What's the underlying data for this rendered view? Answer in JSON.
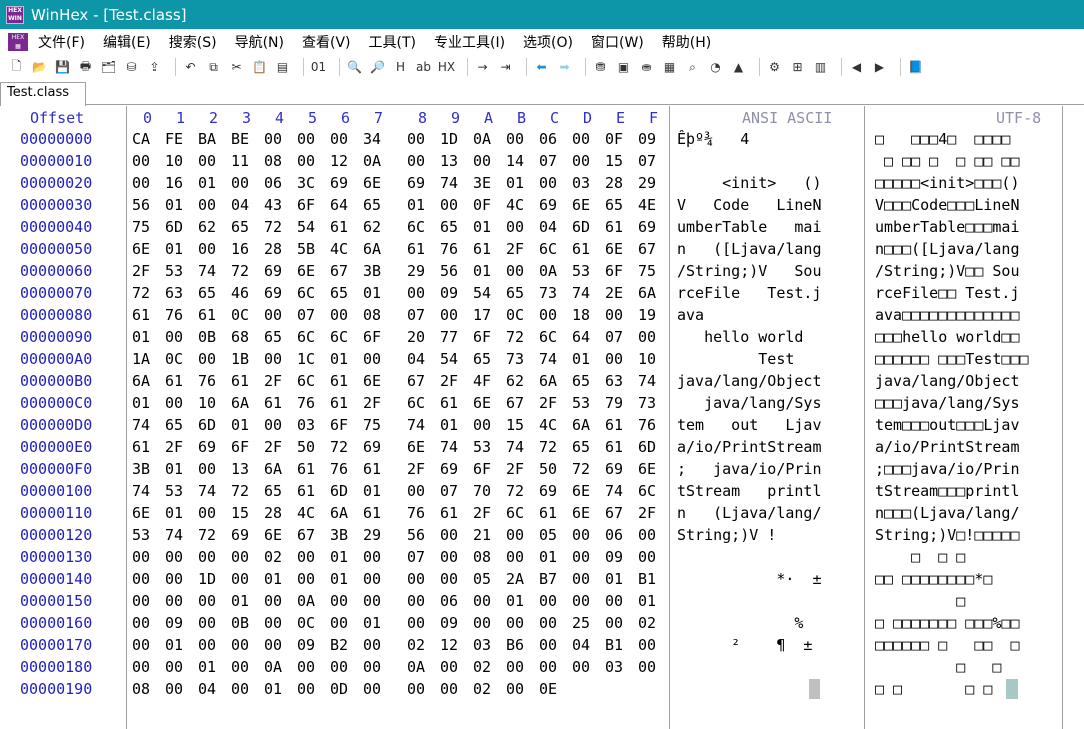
{
  "window": {
    "title": "WinHex - [Test.class]"
  },
  "menu": [
    "文件(F)",
    "编辑(E)",
    "搜索(S)",
    "导航(N)",
    "查看(V)",
    "工具(T)",
    "专业工具(I)",
    "选项(O)",
    "窗口(W)",
    "帮助(H)"
  ],
  "toolbar_icons": [
    "new-file-icon",
    "open-folder-icon",
    "save-icon",
    "print-icon",
    "properties-icon",
    "disk-icon",
    "export-icon",
    "undo-icon",
    "copy-icon",
    "cut-icon",
    "paste-icon",
    "paste-special-icon",
    "binary-icon",
    "find-icon",
    "find-next-icon",
    "find-hex-icon",
    "replace-icon",
    "replace-hex-icon",
    "goto-offset-icon",
    "goto-position-icon",
    "back-icon",
    "forward-icon",
    "disk-open-icon",
    "ram-icon",
    "disk-tools-icon",
    "calculator-icon",
    "search-tool-icon",
    "chart-icon",
    "mask-icon",
    "script-icon",
    "compare-icon",
    "table-icon",
    "prev-block-icon",
    "next-block-icon",
    "help-book-icon"
  ],
  "tab": {
    "label": "Test.class"
  },
  "header": {
    "offset": "Offset",
    "columns": [
      "0",
      "1",
      "2",
      "3",
      "4",
      "5",
      "6",
      "7",
      "8",
      "9",
      "A",
      "B",
      "C",
      "D",
      "E",
      "F"
    ],
    "ansi": "ANSI ASCII",
    "utf": "UTF-8"
  },
  "rows": [
    {
      "offset": "00000000",
      "hex": [
        "CA",
        "FE",
        "BA",
        "BE",
        "00",
        "00",
        "00",
        "34",
        "00",
        "1D",
        "0A",
        "00",
        "06",
        "00",
        "0F",
        "09"
      ],
      "ansi": "Êþº¾   4        ",
      "utf": "□   □□□4□  □□□□"
    },
    {
      "offset": "00000010",
      "hex": [
        "00",
        "10",
        "00",
        "11",
        "08",
        "00",
        "12",
        "0A",
        "00",
        "13",
        "00",
        "14",
        "07",
        "00",
        "15",
        "07"
      ],
      "ansi": "                ",
      "utf": " □ □□ □  □ □□ □□"
    },
    {
      "offset": "00000020",
      "hex": [
        "00",
        "16",
        "01",
        "00",
        "06",
        "3C",
        "69",
        "6E",
        "69",
        "74",
        "3E",
        "01",
        "00",
        "03",
        "28",
        "29"
      ],
      "ansi": "     <init>   ()",
      "utf": "□□□□□<init>□□□()"
    },
    {
      "offset": "00000030",
      "hex": [
        "56",
        "01",
        "00",
        "04",
        "43",
        "6F",
        "64",
        "65",
        "01",
        "00",
        "0F",
        "4C",
        "69",
        "6E",
        "65",
        "4E"
      ],
      "ansi": "V   Code   LineN",
      "utf": "V□□□Code□□□LineN"
    },
    {
      "offset": "00000040",
      "hex": [
        "75",
        "6D",
        "62",
        "65",
        "72",
        "54",
        "61",
        "62",
        "6C",
        "65",
        "01",
        "00",
        "04",
        "6D",
        "61",
        "69"
      ],
      "ansi": "umberTable   mai",
      "utf": "umberTable□□□mai"
    },
    {
      "offset": "00000050",
      "hex": [
        "6E",
        "01",
        "00",
        "16",
        "28",
        "5B",
        "4C",
        "6A",
        "61",
        "76",
        "61",
        "2F",
        "6C",
        "61",
        "6E",
        "67"
      ],
      "ansi": "n   ([Ljava/lang",
      "utf": "n□□□([Ljava/lang"
    },
    {
      "offset": "00000060",
      "hex": [
        "2F",
        "53",
        "74",
        "72",
        "69",
        "6E",
        "67",
        "3B",
        "29",
        "56",
        "01",
        "00",
        "0A",
        "53",
        "6F",
        "75"
      ],
      "ansi": "/String;)V   Sou",
      "utf": "/String;)V□□ Sou"
    },
    {
      "offset": "00000070",
      "hex": [
        "72",
        "63",
        "65",
        "46",
        "69",
        "6C",
        "65",
        "01",
        "00",
        "09",
        "54",
        "65",
        "73",
        "74",
        "2E",
        "6A"
      ],
      "ansi": "rceFile   Test.j",
      "utf": "rceFile□□ Test.j"
    },
    {
      "offset": "00000080",
      "hex": [
        "61",
        "76",
        "61",
        "0C",
        "00",
        "07",
        "00",
        "08",
        "07",
        "00",
        "17",
        "0C",
        "00",
        "18",
        "00",
        "19"
      ],
      "ansi": "ava             ",
      "utf": "ava□□□□□□□□□□□□□"
    },
    {
      "offset": "00000090",
      "hex": [
        "01",
        "00",
        "0B",
        "68",
        "65",
        "6C",
        "6C",
        "6F",
        "20",
        "77",
        "6F",
        "72",
        "6C",
        "64",
        "07",
        "00"
      ],
      "ansi": "   hello world  ",
      "utf": "□□□hello world□□"
    },
    {
      "offset": "000000A0",
      "hex": [
        "1A",
        "0C",
        "00",
        "1B",
        "00",
        "1C",
        "01",
        "00",
        "04",
        "54",
        "65",
        "73",
        "74",
        "01",
        "00",
        "10"
      ],
      "ansi": "         Test   ",
      "utf": "□□□□□□ □□□Test□□□"
    },
    {
      "offset": "000000B0",
      "hex": [
        "6A",
        "61",
        "76",
        "61",
        "2F",
        "6C",
        "61",
        "6E",
        "67",
        "2F",
        "4F",
        "62",
        "6A",
        "65",
        "63",
        "74"
      ],
      "ansi": "java/lang/Object",
      "utf": "java/lang/Object"
    },
    {
      "offset": "000000C0",
      "hex": [
        "01",
        "00",
        "10",
        "6A",
        "61",
        "76",
        "61",
        "2F",
        "6C",
        "61",
        "6E",
        "67",
        "2F",
        "53",
        "79",
        "73"
      ],
      "ansi": "   java/lang/Sys",
      "utf": "□□□java/lang/Sys"
    },
    {
      "offset": "000000D0",
      "hex": [
        "74",
        "65",
        "6D",
        "01",
        "00",
        "03",
        "6F",
        "75",
        "74",
        "01",
        "00",
        "15",
        "4C",
        "6A",
        "61",
        "76"
      ],
      "ansi": "tem   out   Ljav",
      "utf": "tem□□□out□□□Ljav"
    },
    {
      "offset": "000000E0",
      "hex": [
        "61",
        "2F",
        "69",
        "6F",
        "2F",
        "50",
        "72",
        "69",
        "6E",
        "74",
        "53",
        "74",
        "72",
        "65",
        "61",
        "6D"
      ],
      "ansi": "a/io/PrintStream",
      "utf": "a/io/PrintStream"
    },
    {
      "offset": "000000F0",
      "hex": [
        "3B",
        "01",
        "00",
        "13",
        "6A",
        "61",
        "76",
        "61",
        "2F",
        "69",
        "6F",
        "2F",
        "50",
        "72",
        "69",
        "6E"
      ],
      "ansi": ";   java/io/Prin",
      "utf": ";□□□java/io/Prin"
    },
    {
      "offset": "00000100",
      "hex": [
        "74",
        "53",
        "74",
        "72",
        "65",
        "61",
        "6D",
        "01",
        "00",
        "07",
        "70",
        "72",
        "69",
        "6E",
        "74",
        "6C"
      ],
      "ansi": "tStream   printl",
      "utf": "tStream□□□printl"
    },
    {
      "offset": "00000110",
      "hex": [
        "6E",
        "01",
        "00",
        "15",
        "28",
        "4C",
        "6A",
        "61",
        "76",
        "61",
        "2F",
        "6C",
        "61",
        "6E",
        "67",
        "2F"
      ],
      "ansi": "n   (Ljava/lang/",
      "utf": "n□□□(Ljava/lang/"
    },
    {
      "offset": "00000120",
      "hex": [
        "53",
        "74",
        "72",
        "69",
        "6E",
        "67",
        "3B",
        "29",
        "56",
        "00",
        "21",
        "00",
        "05",
        "00",
        "06",
        "00"
      ],
      "ansi": "String;)V !     ",
      "utf": "String;)V□!□□□□□"
    },
    {
      "offset": "00000130",
      "hex": [
        "00",
        "00",
        "00",
        "00",
        "02",
        "00",
        "01",
        "00",
        "07",
        "00",
        "08",
        "00",
        "01",
        "00",
        "09",
        "00"
      ],
      "ansi": "                ",
      "utf": "    □  □ □      "
    },
    {
      "offset": "00000140",
      "hex": [
        "00",
        "00",
        "1D",
        "00",
        "01",
        "00",
        "01",
        "00",
        "00",
        "00",
        "05",
        "2A",
        "B7",
        "00",
        "01",
        "B1"
      ],
      "ansi": "           *·  ±",
      "utf": "□□ □□□□□□□□*□   "
    },
    {
      "offset": "00000150",
      "hex": [
        "00",
        "00",
        "00",
        "01",
        "00",
        "0A",
        "00",
        "00",
        "00",
        "06",
        "00",
        "01",
        "00",
        "00",
        "00",
        "01"
      ],
      "ansi": "                ",
      "utf": "         □      "
    },
    {
      "offset": "00000160",
      "hex": [
        "00",
        "09",
        "00",
        "0B",
        "00",
        "0C",
        "00",
        "01",
        "00",
        "09",
        "00",
        "00",
        "00",
        "25",
        "00",
        "02"
      ],
      "ansi": "             %  ",
      "utf": "□ □□□□□□□ □□□%□□"
    },
    {
      "offset": "00000170",
      "hex": [
        "00",
        "01",
        "00",
        "00",
        "00",
        "09",
        "B2",
        "00",
        "02",
        "12",
        "03",
        "B6",
        "00",
        "04",
        "B1",
        "00"
      ],
      "ansi": "      ²    ¶  ± ",
      "utf": "□□□□□□ □   □□  □"
    },
    {
      "offset": "00000180",
      "hex": [
        "00",
        "00",
        "01",
        "00",
        "0A",
        "00",
        "00",
        "00",
        "0A",
        "00",
        "02",
        "00",
        "00",
        "00",
        "03",
        "00"
      ],
      "ansi": "                ",
      "utf": "         □   □  "
    },
    {
      "offset": "00000190",
      "hex": [
        "08",
        "00",
        "04",
        "00",
        "01",
        "00",
        "0D",
        "00",
        "00",
        "00",
        "02",
        "00",
        "0E"
      ],
      "ansi": "                ",
      "utf": "□ □       □ □   "
    }
  ]
}
